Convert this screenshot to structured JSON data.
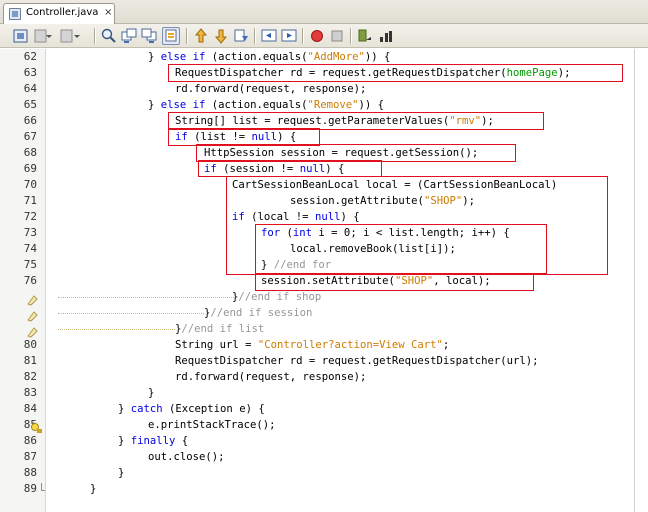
{
  "tab": {
    "title": "Controller.java",
    "close_glyph": "×"
  },
  "toolbar": {
    "icons": [
      "editor-history-icon",
      "back-icon",
      "forward-icon",
      "find-icon",
      "find-prev-icon",
      "find-next-icon",
      "toggle-highlight-icon",
      "prev-bookmark-icon",
      "next-bookmark-icon",
      "toggle-bookmark-icon",
      "shift-left-icon",
      "shift-right-icon",
      "start-macro-icon",
      "stop-macro-icon",
      "comment-icon",
      "uncomment-icon"
    ]
  },
  "code": {
    "lines": [
      {
        "num": "62",
        "text": "} else if (action.equals(\"AddMore\")) {"
      },
      {
        "num": "63",
        "text": "RequestDispatcher rd = request.getRequestDispatcher(homePage);"
      },
      {
        "num": "64",
        "text": "rd.forward(request, response);"
      },
      {
        "num": "65",
        "text": "} else if (action.equals(\"Remove\")) {"
      },
      {
        "num": "66",
        "text": "String[] list = request.getParameterValues(\"rmv\");"
      },
      {
        "num": "67",
        "text": "if (list != null) {"
      },
      {
        "num": "68",
        "text": "HttpSession session = request.getSession();"
      },
      {
        "num": "69",
        "text": "if (session != null) {"
      },
      {
        "num": "70",
        "text": "CartSessionBeanLocal local = (CartSessionBeanLocal)"
      },
      {
        "num": "71",
        "text": "session.getAttribute(\"SHOP\");"
      },
      {
        "num": "72",
        "text": "if (local != null) {"
      },
      {
        "num": "73",
        "text": "for (int i = 0; i < list.length; i++) {"
      },
      {
        "num": "74",
        "text": "local.removeBook(list[i]);"
      },
      {
        "num": "75",
        "text": "} //end for"
      },
      {
        "num": "76",
        "text": "session.setAttribute(\"SHOP\", local);"
      },
      {
        "num": "",
        "text": "}//end if shop"
      },
      {
        "num": "",
        "text": "}//end if session"
      },
      {
        "num": "",
        "text": "}//end if list"
      },
      {
        "num": "80",
        "text": "String url = \"Controller?action=View Cart\";"
      },
      {
        "num": "81",
        "text": "RequestDispatcher rd = request.getRequestDispatcher(url);"
      },
      {
        "num": "82",
        "text": "rd.forward(request, response);"
      },
      {
        "num": "83",
        "text": "}"
      },
      {
        "num": "84",
        "text": "} catch (Exception e) {"
      },
      {
        "num": "85",
        "text": "e.printStackTrace();"
      },
      {
        "num": "86",
        "text": "} finally {"
      },
      {
        "num": "87",
        "text": "out.close();"
      },
      {
        "num": "88",
        "text": "}"
      },
      {
        "num": "89",
        "text": "}"
      }
    ]
  },
  "colors": {
    "keyword": "#0000e6",
    "string": "#ce7b00",
    "comment": "#969696",
    "field": "#009900",
    "highlight_box": "#e0101e"
  }
}
